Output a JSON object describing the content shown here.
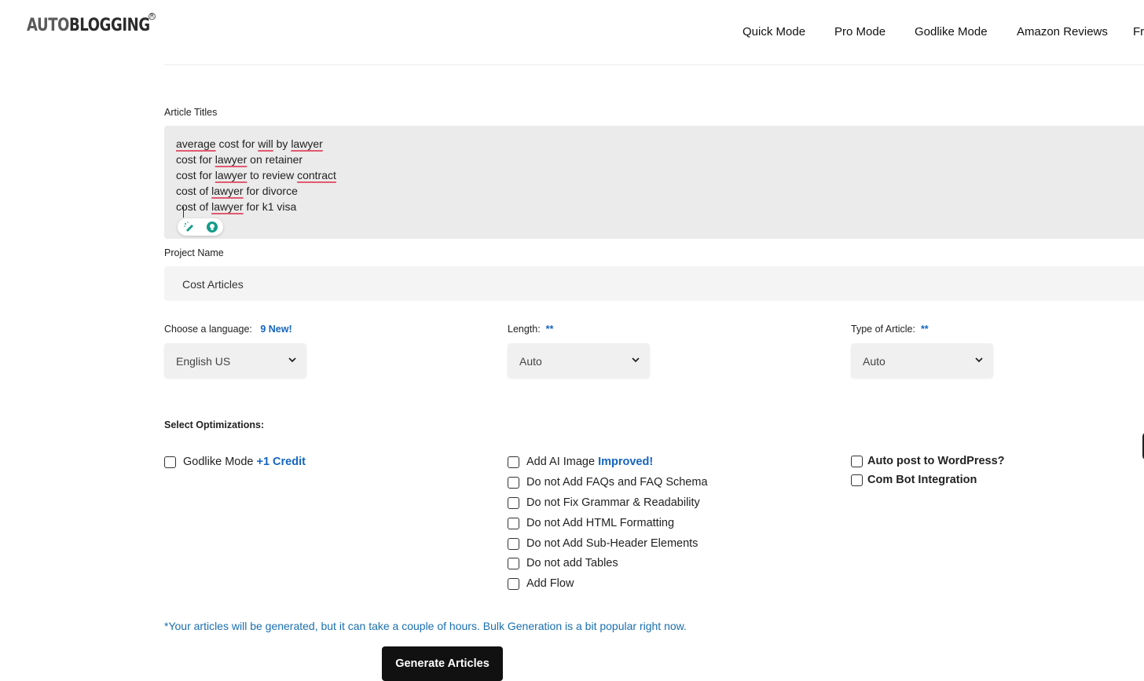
{
  "logo": {
    "part1": "AUTO",
    "part2": "BLOGGING",
    "reg": "R"
  },
  "nav": {
    "items": [
      "Quick Mode",
      "Pro Mode",
      "Godlike Mode",
      "Amazon Reviews",
      "Fr"
    ]
  },
  "titles": {
    "label": "Article Titles",
    "lines": [
      [
        "average",
        " cost for ",
        "will",
        " by ",
        "lawyer",
        ""
      ],
      [
        "cost for ",
        "lawyer",
        " on retainer"
      ],
      [
        "cost for ",
        "lawyer",
        " to review ",
        "contract",
        ""
      ],
      [
        "cost of ",
        "lawyer",
        " for divorce"
      ],
      [
        "cost of ",
        "lawyer",
        " for k1 visa"
      ]
    ]
  },
  "project": {
    "label": "Project Name",
    "value": "Cost Articles"
  },
  "language": {
    "label": "Choose a language:",
    "badge": "9 New!",
    "value": "English US"
  },
  "length": {
    "label": "Length:",
    "badge": "**",
    "value": "Auto"
  },
  "type": {
    "label": "Type of Article:",
    "badge": "**",
    "value": "Auto"
  },
  "optimizations": {
    "label": "Select Optimizations:",
    "godlike": {
      "label": "Godlike Mode",
      "badge": "+1 Credit"
    },
    "middle": [
      {
        "label": "Add AI Image",
        "badge": "Improved!"
      },
      {
        "label": "Do not Add FAQs and FAQ Schema"
      },
      {
        "label": "Do not Fix Grammar & Readability"
      },
      {
        "label": "Do not Add HTML Formatting"
      },
      {
        "label": "Do not Add Sub-Header Elements"
      },
      {
        "label": "Do not add Tables"
      },
      {
        "label": "Add Flow"
      }
    ],
    "right": [
      {
        "label": "Auto post to WordPress?"
      },
      {
        "label": "Com Bot Integration"
      }
    ]
  },
  "note": "*Your articles will be generated, but it can take a couple of hours. Bulk Generation is a bit popular right now.",
  "generate_button": "Generate Articles"
}
